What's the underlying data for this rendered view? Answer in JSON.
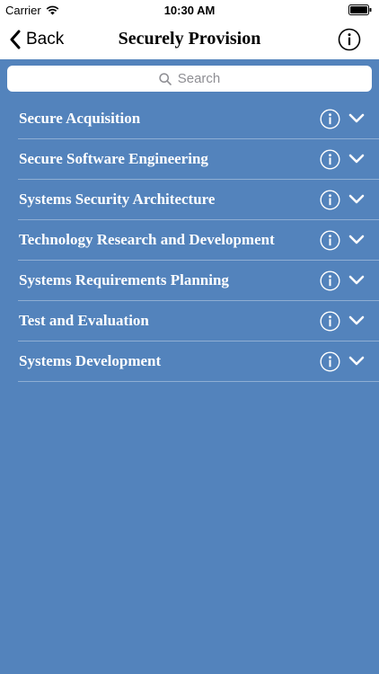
{
  "status_bar": {
    "carrier": "Carrier",
    "time": "10:30 AM"
  },
  "nav": {
    "back_label": "Back",
    "title": "Securely Provision"
  },
  "search": {
    "placeholder": "Search"
  },
  "list": {
    "items": [
      {
        "label": "Secure Acquisition"
      },
      {
        "label": "Secure Software Engineering"
      },
      {
        "label": "Systems Security Architecture"
      },
      {
        "label": "Technology Research and Development"
      },
      {
        "label": "Systems Requirements Planning"
      },
      {
        "label": "Test and Evaluation"
      },
      {
        "label": "Systems Development"
      }
    ]
  },
  "colors": {
    "background": "#5383bc",
    "bar": "#ffffff",
    "text_light": "#ffffff"
  },
  "icons": [
    "wifi-icon",
    "battery-icon",
    "back-chevron-icon",
    "info-icon",
    "search-icon",
    "chevron-down-icon"
  ]
}
